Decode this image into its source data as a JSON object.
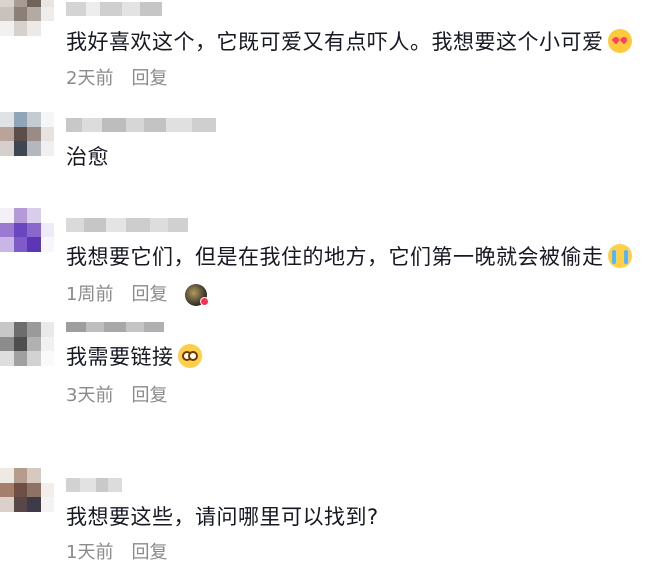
{
  "comments": [
    {
      "text": "我好喜欢这个，它既可爱又有点吓人。我想要这个小可爱",
      "emoji": "smiling-face-with-hearts-icon",
      "time": "2天前",
      "reply": "回复"
    },
    {
      "text": "治愈",
      "time": "",
      "reply": ""
    },
    {
      "text": "我想要它们，但是在我住的地方，它们第一晚就会被偷走",
      "emoji": "loudly-crying-face-icon",
      "time": "1周前",
      "reply": "回复"
    },
    {
      "text": "我需要链接",
      "emoji": "flushed-face-icon",
      "time": "3天前",
      "reply": "回复"
    },
    {
      "text": "我想要这些，请问哪里可以找到?",
      "time": "1天前",
      "reply": "回复"
    }
  ],
  "colors": {
    "text": "#161823",
    "meta": "#8a8a8a",
    "background": "#ffffff"
  }
}
